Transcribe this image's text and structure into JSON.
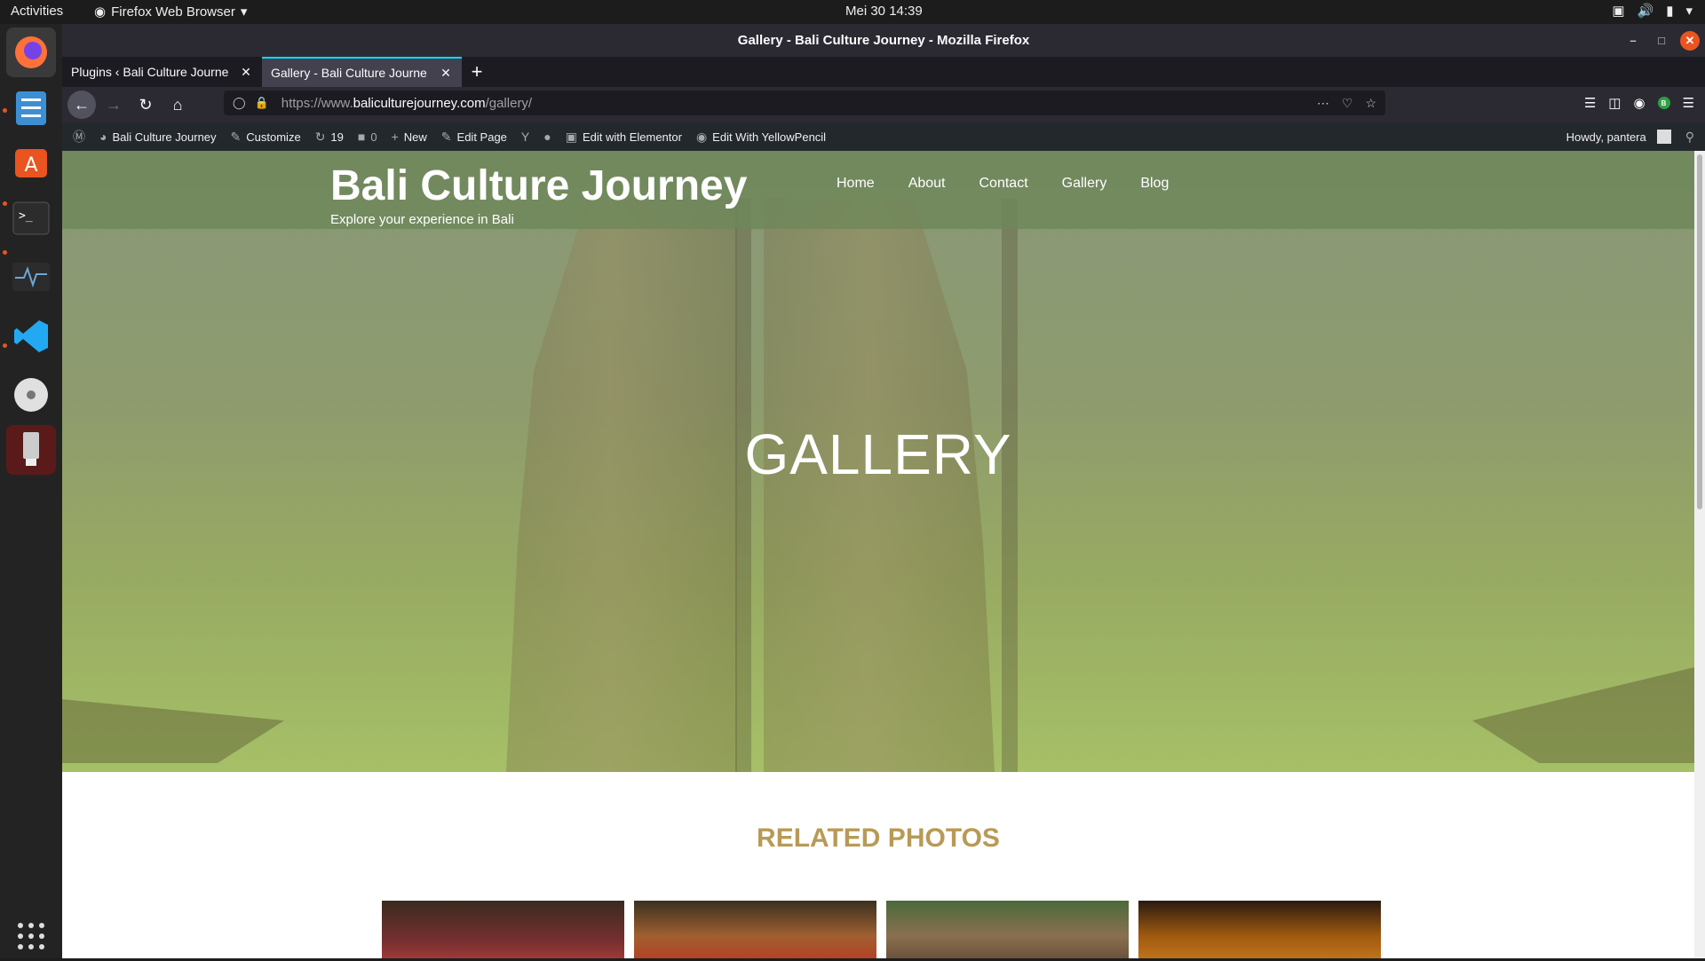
{
  "topbar": {
    "activities": "Activities",
    "app_menu": "Firefox Web Browser",
    "clock": "Mei 30  14:39"
  },
  "window": {
    "title": "Gallery - Bali Culture Journey - Mozilla Firefox"
  },
  "tabs": [
    {
      "label": "Plugins ‹ Bali Culture Journe",
      "active": false
    },
    {
      "label": "Gallery - Bali Culture Journe",
      "active": true
    }
  ],
  "url": {
    "prefix": "https://www.",
    "domain": "baliculturejourney.com",
    "path": "/gallery/"
  },
  "wp_admin_bar": {
    "site_name": "Bali Culture Journey",
    "customize": "Customize",
    "updates_count": "19",
    "comments_count": "0",
    "new": "New",
    "edit_page": "Edit Page",
    "edit_elementor": "Edit with Elementor",
    "edit_yellowpencil": "Edit With YellowPencil",
    "howdy": "Howdy, pantera"
  },
  "site": {
    "title": "Bali Culture Journey",
    "tagline": "Explore your experience in Bali",
    "nav": [
      "Home",
      "About",
      "Contact",
      "Gallery",
      "Blog"
    ],
    "hero_heading": "GALLERY",
    "related_heading": "RELATED PHOTOS"
  },
  "colors": {
    "accent_heading": "#b89a55",
    "wp_bar": "#23282d",
    "tab_highlight": "#00ddff"
  }
}
